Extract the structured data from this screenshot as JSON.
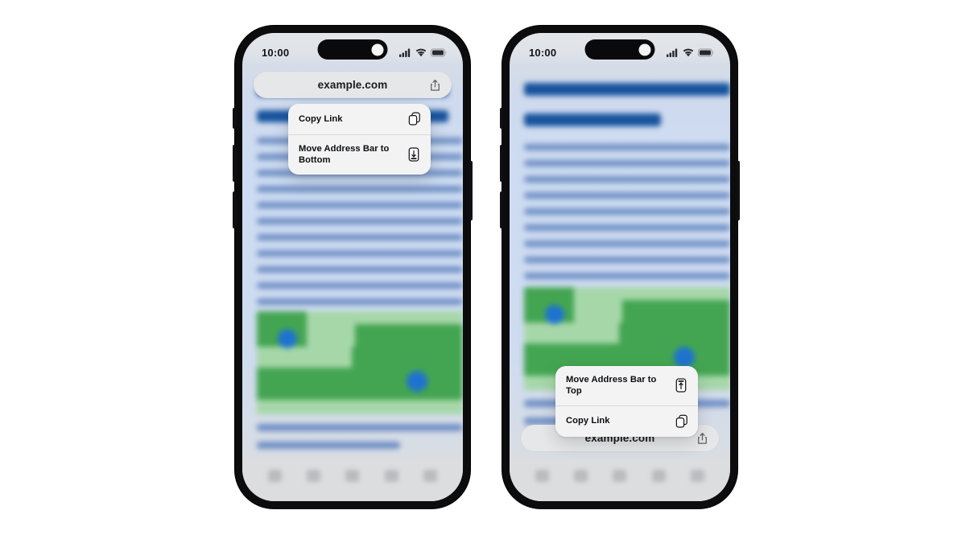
{
  "background_color": "#ffffff",
  "phones": [
    {
      "id": "phone-address-bar-top",
      "status_bar": {
        "time": "10:00",
        "icons": [
          "cellular-signal-icon",
          "wifi-icon",
          "battery-icon"
        ]
      },
      "address_bar": {
        "position": "top",
        "url": "example.com",
        "share_icon": "share-icon"
      },
      "context_menu": {
        "items": [
          {
            "label": "Copy Link",
            "icon": "copy-link-icon"
          },
          {
            "label": "Move Address Bar to Bottom",
            "icon": "move-address-bar-down-icon"
          }
        ]
      },
      "toolbar": {
        "icons": [
          "back-icon",
          "forward-icon",
          "share-icon",
          "bookmarks-icon",
          "tabs-icon"
        ]
      }
    },
    {
      "id": "phone-address-bar-bottom",
      "status_bar": {
        "time": "10:00",
        "icons": [
          "cellular-signal-icon",
          "wifi-icon",
          "battery-icon"
        ]
      },
      "address_bar": {
        "position": "bottom",
        "url": "example.com",
        "share_icon": "share-icon"
      },
      "context_menu": {
        "items": [
          {
            "label": "Move Address Bar to Top",
            "icon": "move-address-bar-up-icon"
          },
          {
            "label": "Copy Link",
            "icon": "copy-link-icon"
          }
        ]
      },
      "toolbar": {
        "icons": [
          "back-icon",
          "forward-icon",
          "share-icon",
          "bookmarks-icon",
          "tabs-icon"
        ]
      }
    }
  ],
  "colors": {
    "heading_blue": "#17539e",
    "body_blue": "#6f8fc4",
    "map_green": "#43a551",
    "map_light_green": "#a6d7a8",
    "pin_blue": "#1f73cf",
    "menu_background": "#f3f3f4",
    "address_bar_background": "#e6e7e8",
    "frame_black": "#0c0c0e"
  }
}
